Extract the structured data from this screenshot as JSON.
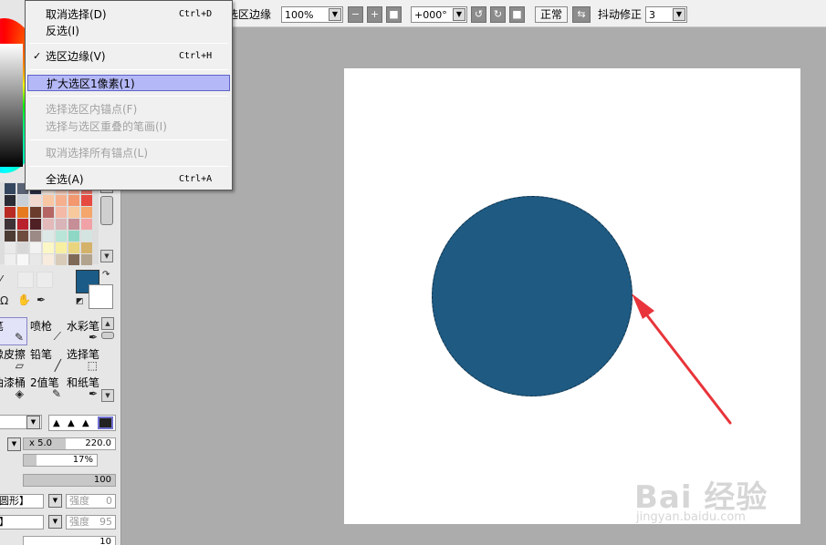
{
  "toolbar": {
    "selection_edge_label": "选区边缘",
    "zoom_value": "100%",
    "rotation_value": "+000°",
    "blend_mode": "正常",
    "stabilizer_label": "抖动修正",
    "stabilizer_value": "3"
  },
  "menu": {
    "items": [
      {
        "label": "取消选择(D)",
        "shortcut": "Ctrl+D",
        "enabled": true
      },
      {
        "label": "反选(I)",
        "shortcut": "",
        "enabled": true
      },
      {
        "label": "选区边缘(V)",
        "shortcut": "Ctrl+H",
        "enabled": true,
        "checked": true
      },
      {
        "label": "扩大选区1像素(1)",
        "shortcut": "",
        "enabled": true,
        "highlighted": true
      },
      {
        "label": "选择选区内锚点(F)",
        "shortcut": "",
        "enabled": false
      },
      {
        "label": "选择与选区重叠的笔画(I)",
        "shortcut": "",
        "enabled": false
      },
      {
        "label": "取消选择所有锚点(L)",
        "shortcut": "",
        "enabled": false
      },
      {
        "label": "全选(A)",
        "shortcut": "Ctrl+A",
        "enabled": true
      }
    ],
    "checkmark": "✓"
  },
  "tools": [
    {
      "label": "笔"
    },
    {
      "label": "喷枪"
    },
    {
      "label": "水彩笔"
    },
    {
      "label": "橡皮擦"
    },
    {
      "label": "铅笔"
    },
    {
      "label": "选择笔"
    },
    {
      "label": "油漆桶"
    },
    {
      "label": "2值笔"
    },
    {
      "label": "和纸笔"
    }
  ],
  "brush": {
    "size_multiplier": "x 5.0",
    "size_value": "220.0",
    "min_size": "17%",
    "min_size_fraction": 0.17,
    "density": "100",
    "density_fraction": 1.0,
    "shape_label": "圆形】",
    "shape_strength_label": "强度",
    "shape_strength_value": "0",
    "texture_label": "】",
    "texture_strength_label": "强度",
    "texture_strength_value": "95",
    "last_value": "10"
  },
  "colors": {
    "foreground": "#1a5c87",
    "circle_fill": "#1e5a82",
    "canvas": "#ffffff",
    "workspace": "#acacac",
    "arrow": "#e8343a",
    "menu_highlight": "#b4b8f6"
  },
  "canvas": {
    "content": "blue circle with dashed selection outline, red arrow pointing at edge"
  },
  "watermark": {
    "main": "Bai 经验",
    "url": "jingyan.baidu.com"
  }
}
